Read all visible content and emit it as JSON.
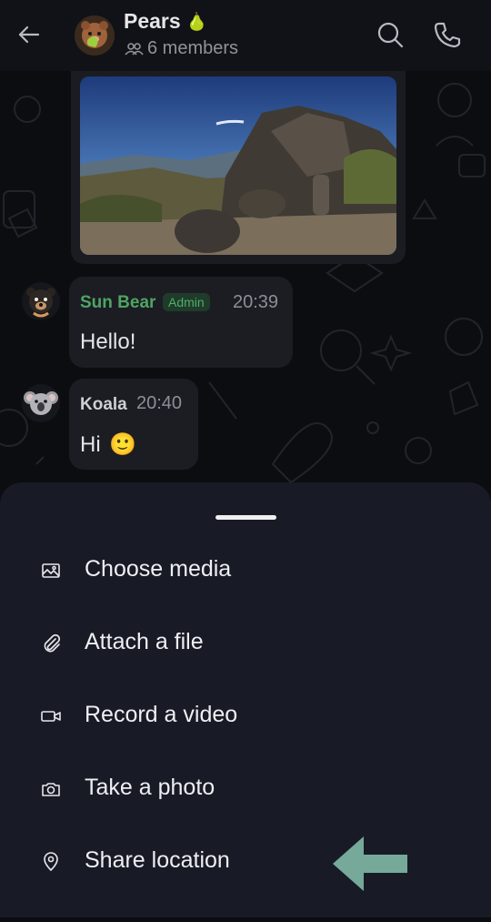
{
  "header": {
    "title": "Pears",
    "title_emoji": "🍐",
    "members": "6 members"
  },
  "messages": [
    {
      "type": "image",
      "alt": "photo"
    },
    {
      "sender": "Sun Bear",
      "badge": "Admin",
      "time": "20:39",
      "text": "Hello!",
      "sender_color": "#4fa463"
    },
    {
      "sender": "Koala",
      "time": "20:40",
      "text": "Hi",
      "emoji": "🙂",
      "sender_color": "#cfd0d6"
    }
  ],
  "sheet": {
    "items": [
      {
        "label": "Choose media",
        "icon": "image-icon"
      },
      {
        "label": "Attach a file",
        "icon": "paperclip-icon"
      },
      {
        "label": "Record a video",
        "icon": "video-camera-icon"
      },
      {
        "label": "Take a photo",
        "icon": "camera-icon"
      },
      {
        "label": "Share location",
        "icon": "location-pin-icon"
      }
    ]
  },
  "colors": {
    "accent_arrow": "#76a99a",
    "admin": "#4fae6a"
  }
}
